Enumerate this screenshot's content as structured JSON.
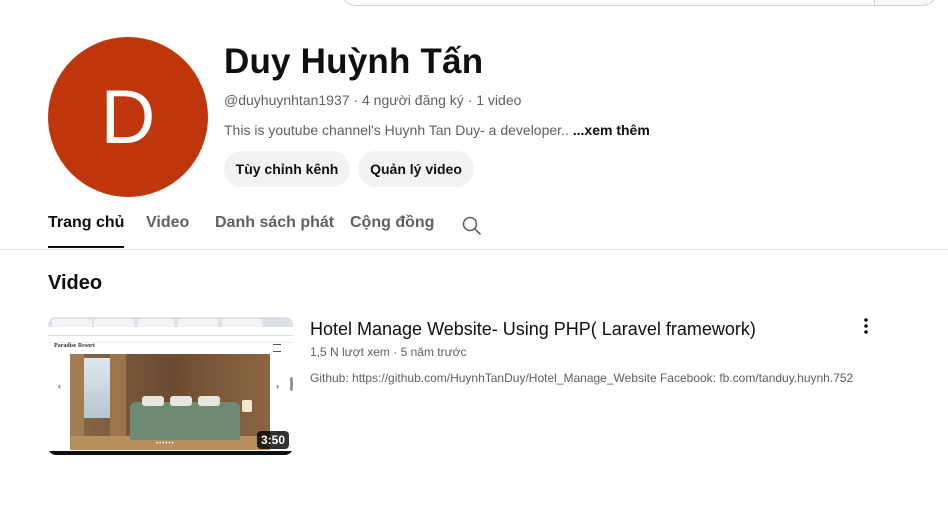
{
  "channel": {
    "avatar_letter": "D",
    "avatar_color": "#bf360c",
    "name": "Duy Huỳnh Tấn",
    "meta": "@duyhuynhtan1937 · 4 người đăng ký · 1 video",
    "description": "This is youtube channel's Huynh Tan Duy- a developer..",
    "more_label": "...xem thêm",
    "customize_button": "Tùy chỉnh kênh",
    "manage_button": "Quản lý video"
  },
  "tabs": [
    {
      "label": "Trang chủ",
      "active": true
    },
    {
      "label": "Video",
      "active": false
    },
    {
      "label": "Danh sách phát",
      "active": false
    },
    {
      "label": "Cộng đồng",
      "active": false
    }
  ],
  "tab_search_icon": "search-icon",
  "section": {
    "title": "Video"
  },
  "video": {
    "title": "Hotel Manage Website- Using PHP( Laravel framework)",
    "meta": "1,5 N lượt xem · 5 năm trước",
    "description": "Github: https://github.com/HuynhTanDuy/Hotel_Manage_Website Facebook: fb.com/tanduy.huynh.752",
    "duration": "3:50",
    "thumbnail_site_title": "Paradise Resort",
    "more_icon": "more-vert-icon"
  }
}
